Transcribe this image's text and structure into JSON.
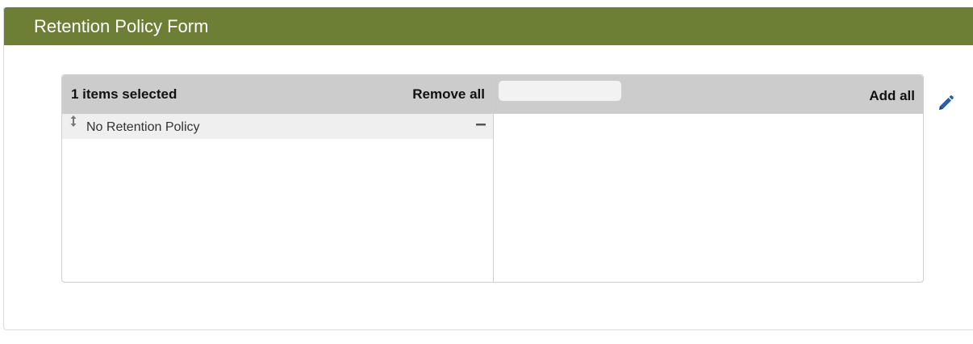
{
  "form": {
    "title": "Retention Policy Form"
  },
  "picklist": {
    "selected": {
      "count_label": "1 items selected",
      "remove_all_label": "Remove all",
      "items": [
        {
          "label": "No Retention Policy"
        }
      ]
    },
    "available": {
      "filter_value": "",
      "filter_placeholder": "",
      "add_all_label": "Add all",
      "items": []
    }
  },
  "icons": {
    "drag": "drag-handle-icon",
    "remove": "minus-icon",
    "edit": "pencil-icon"
  },
  "colors": {
    "header_bg": "#6d7f35",
    "column_header_bg": "#cccccc",
    "item_bg": "#efefef",
    "edit_icon": "#2a5db0"
  }
}
